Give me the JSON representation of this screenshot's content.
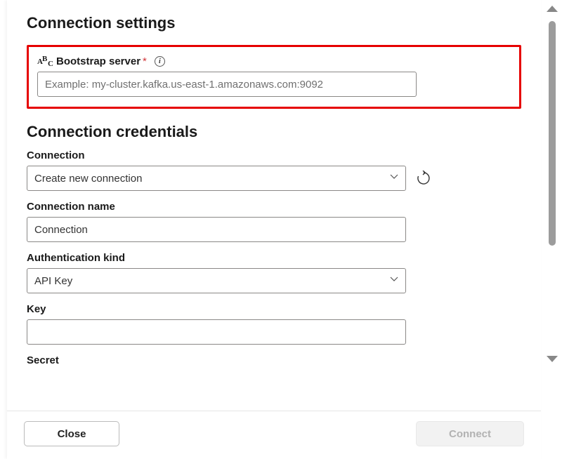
{
  "connection_settings": {
    "title": "Connection settings",
    "bootstrap_server": {
      "label": "Bootstrap server",
      "placeholder": "Example: my-cluster.kafka.us-east-1.amazonaws.com:9092",
      "value": ""
    }
  },
  "connection_credentials": {
    "title": "Connection credentials",
    "connection": {
      "label": "Connection",
      "selected": "Create new connection"
    },
    "connection_name": {
      "label": "Connection name",
      "value": "Connection"
    },
    "authentication_kind": {
      "label": "Authentication kind",
      "selected": "API Key"
    },
    "key": {
      "label": "Key",
      "value": ""
    },
    "secret": {
      "label": "Secret"
    }
  },
  "footer": {
    "close_label": "Close",
    "connect_label": "Connect"
  }
}
